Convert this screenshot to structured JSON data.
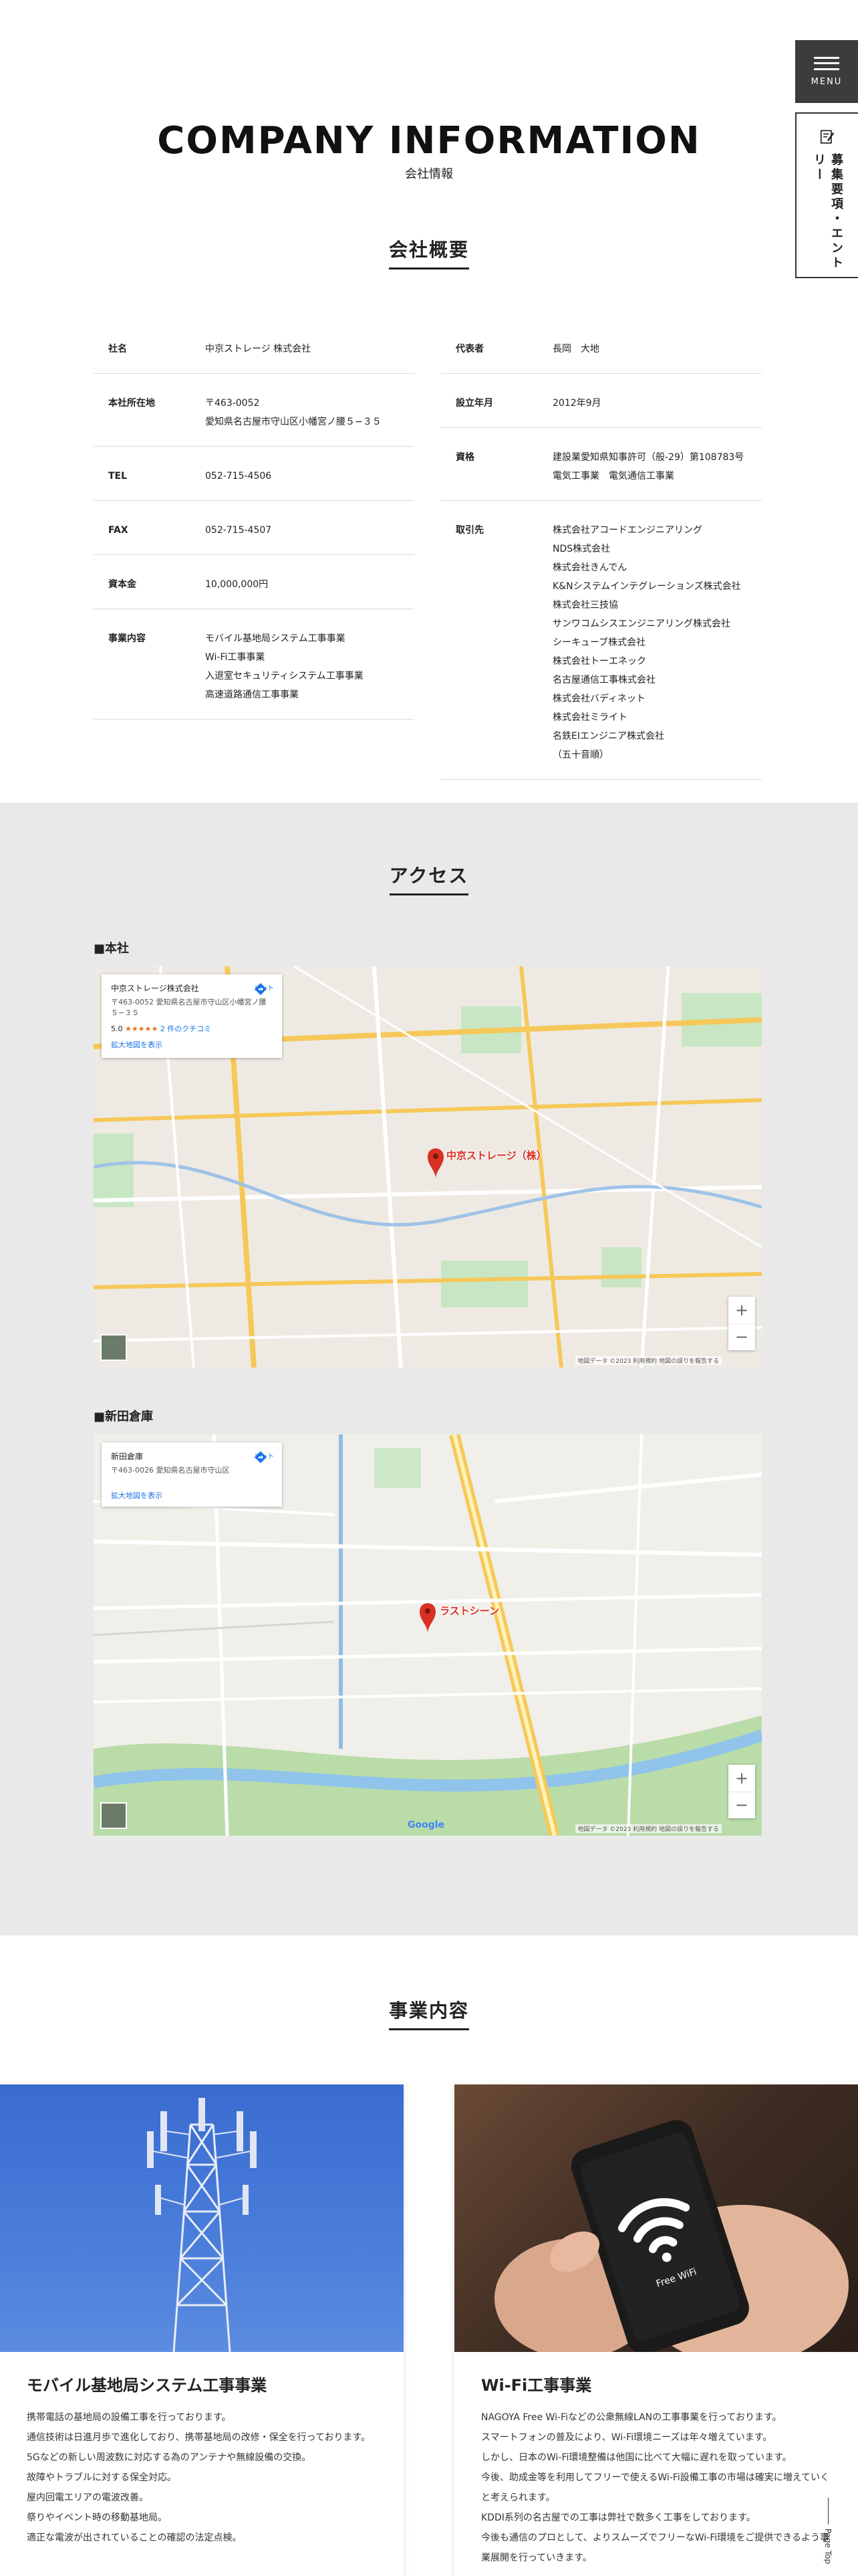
{
  "nav": {
    "menu_label": "MENU",
    "recruit_label": "募集要項・エントリー"
  },
  "header": {
    "title_en": "COMPANY INFORMATION",
    "title_ja": "会社情報"
  },
  "overview": {
    "title": "会社概要",
    "left": [
      {
        "label": "社名",
        "value": "中京ストレージ 株式会社"
      },
      {
        "label": "本社所在地",
        "value": "〒463-0052\n愛知県名古屋市守山区小幡宮ノ腰５−３５"
      },
      {
        "label": "TEL",
        "value": "052-715-4506"
      },
      {
        "label": "FAX",
        "value": "052-715-4507"
      },
      {
        "label": "資本金",
        "value": "10,000,000円"
      },
      {
        "label": "事業内容",
        "value": "モバイル基地局システム工事事業\nWi-Fi工事事業\n入退室セキュリティシステム工事事業\n高速道路通信工事事業"
      }
    ],
    "right": [
      {
        "label": "代表者",
        "value": "長岡　大地"
      },
      {
        "label": "設立年月",
        "value": "2012年9月"
      },
      {
        "label": "資格",
        "value": "建設業愛知県知事許可（般-29）第108783号\n電気工事業　電気通信工事業"
      },
      {
        "label": "取引先",
        "value": "株式会社アコードエンジニアリング\nNDS株式会社\n株式会社きんでん\nK&Nシステムインテグレーションズ株式会社\n株式会社三技協\nサンワコムシスエンジニアリング株式会社\nシーキューブ株式会社\n株式会社トーエネック\n名古屋通信工事株式会社\n株式会社バディネット\n株式会社ミライト\n名鉄EIエンジニア株式会社\n（五十音順）"
      }
    ]
  },
  "access": {
    "title": "アクセス",
    "main_office": {
      "heading": "■本社",
      "card_title": "中京ストレージ株式会社",
      "card_address": "〒463-0052 愛知県名古屋市守山区小幡宮ノ腰５−３５",
      "rating": "5.0",
      "stars": "★★★★★",
      "reviews": "2 件のクチコミ",
      "link": "拡大地図を表示",
      "directions": "ルート",
      "pin_label": "中京ストレージ（株）",
      "footer": "地図データ ©2023  利用規約  地図の誤りを報告する"
    },
    "warehouse": {
      "heading": "■新田倉庫",
      "card_title": "新田倉庫",
      "card_address": "〒463-0026 愛知県名古屋市守山区",
      "link": "拡大地図を表示",
      "directions": "ルート",
      "pin_label": "ラストシーン",
      "footer": "地図データ ©2023  利用規約  地図の誤りを報告する",
      "logo": "Google"
    }
  },
  "business": {
    "title": "事業内容",
    "cards": [
      {
        "title": "モバイル基地局システム工事事業",
        "body": "携帯電話の基地局の設備工事を行っております。\n通信技術は日進月歩で進化しており、携帯基地局の改修・保全を行っております。\n5Gなどの新しい周波数に対応する為のアンテナや無線設備の交換。\n故障やトラブルに対する保全対応。\n屋内回電エリアの電波改善。\n祭りやイベント時の移動基地局。\n適正な電波が出されていることの確認の法定点検。"
      },
      {
        "title": "Wi-Fi工事事業",
        "body": "NAGOYA Free Wi-Fiなどの公衆無線LANの工事事業を行っております。\nスマートフォンの普及により、Wi-Fi環境ニーズは年々増えています。\nしかし、日本のWi-Fi環境整備は他国に比べて大幅に遅れを取っています。\n今後、助成金等を利用してフリーで使えるWi-Fi設備工事の市場は確実に増えていくと考えられます。\nKDDI系列の名古屋での工事は弊社で数多く工事をしております。\n今後も通信のプロとして、よりスムーズでフリーなWi-Fi環境をご提供できるよう事業展開を行っていきます。"
      }
    ]
  },
  "page_top": "Page Top"
}
